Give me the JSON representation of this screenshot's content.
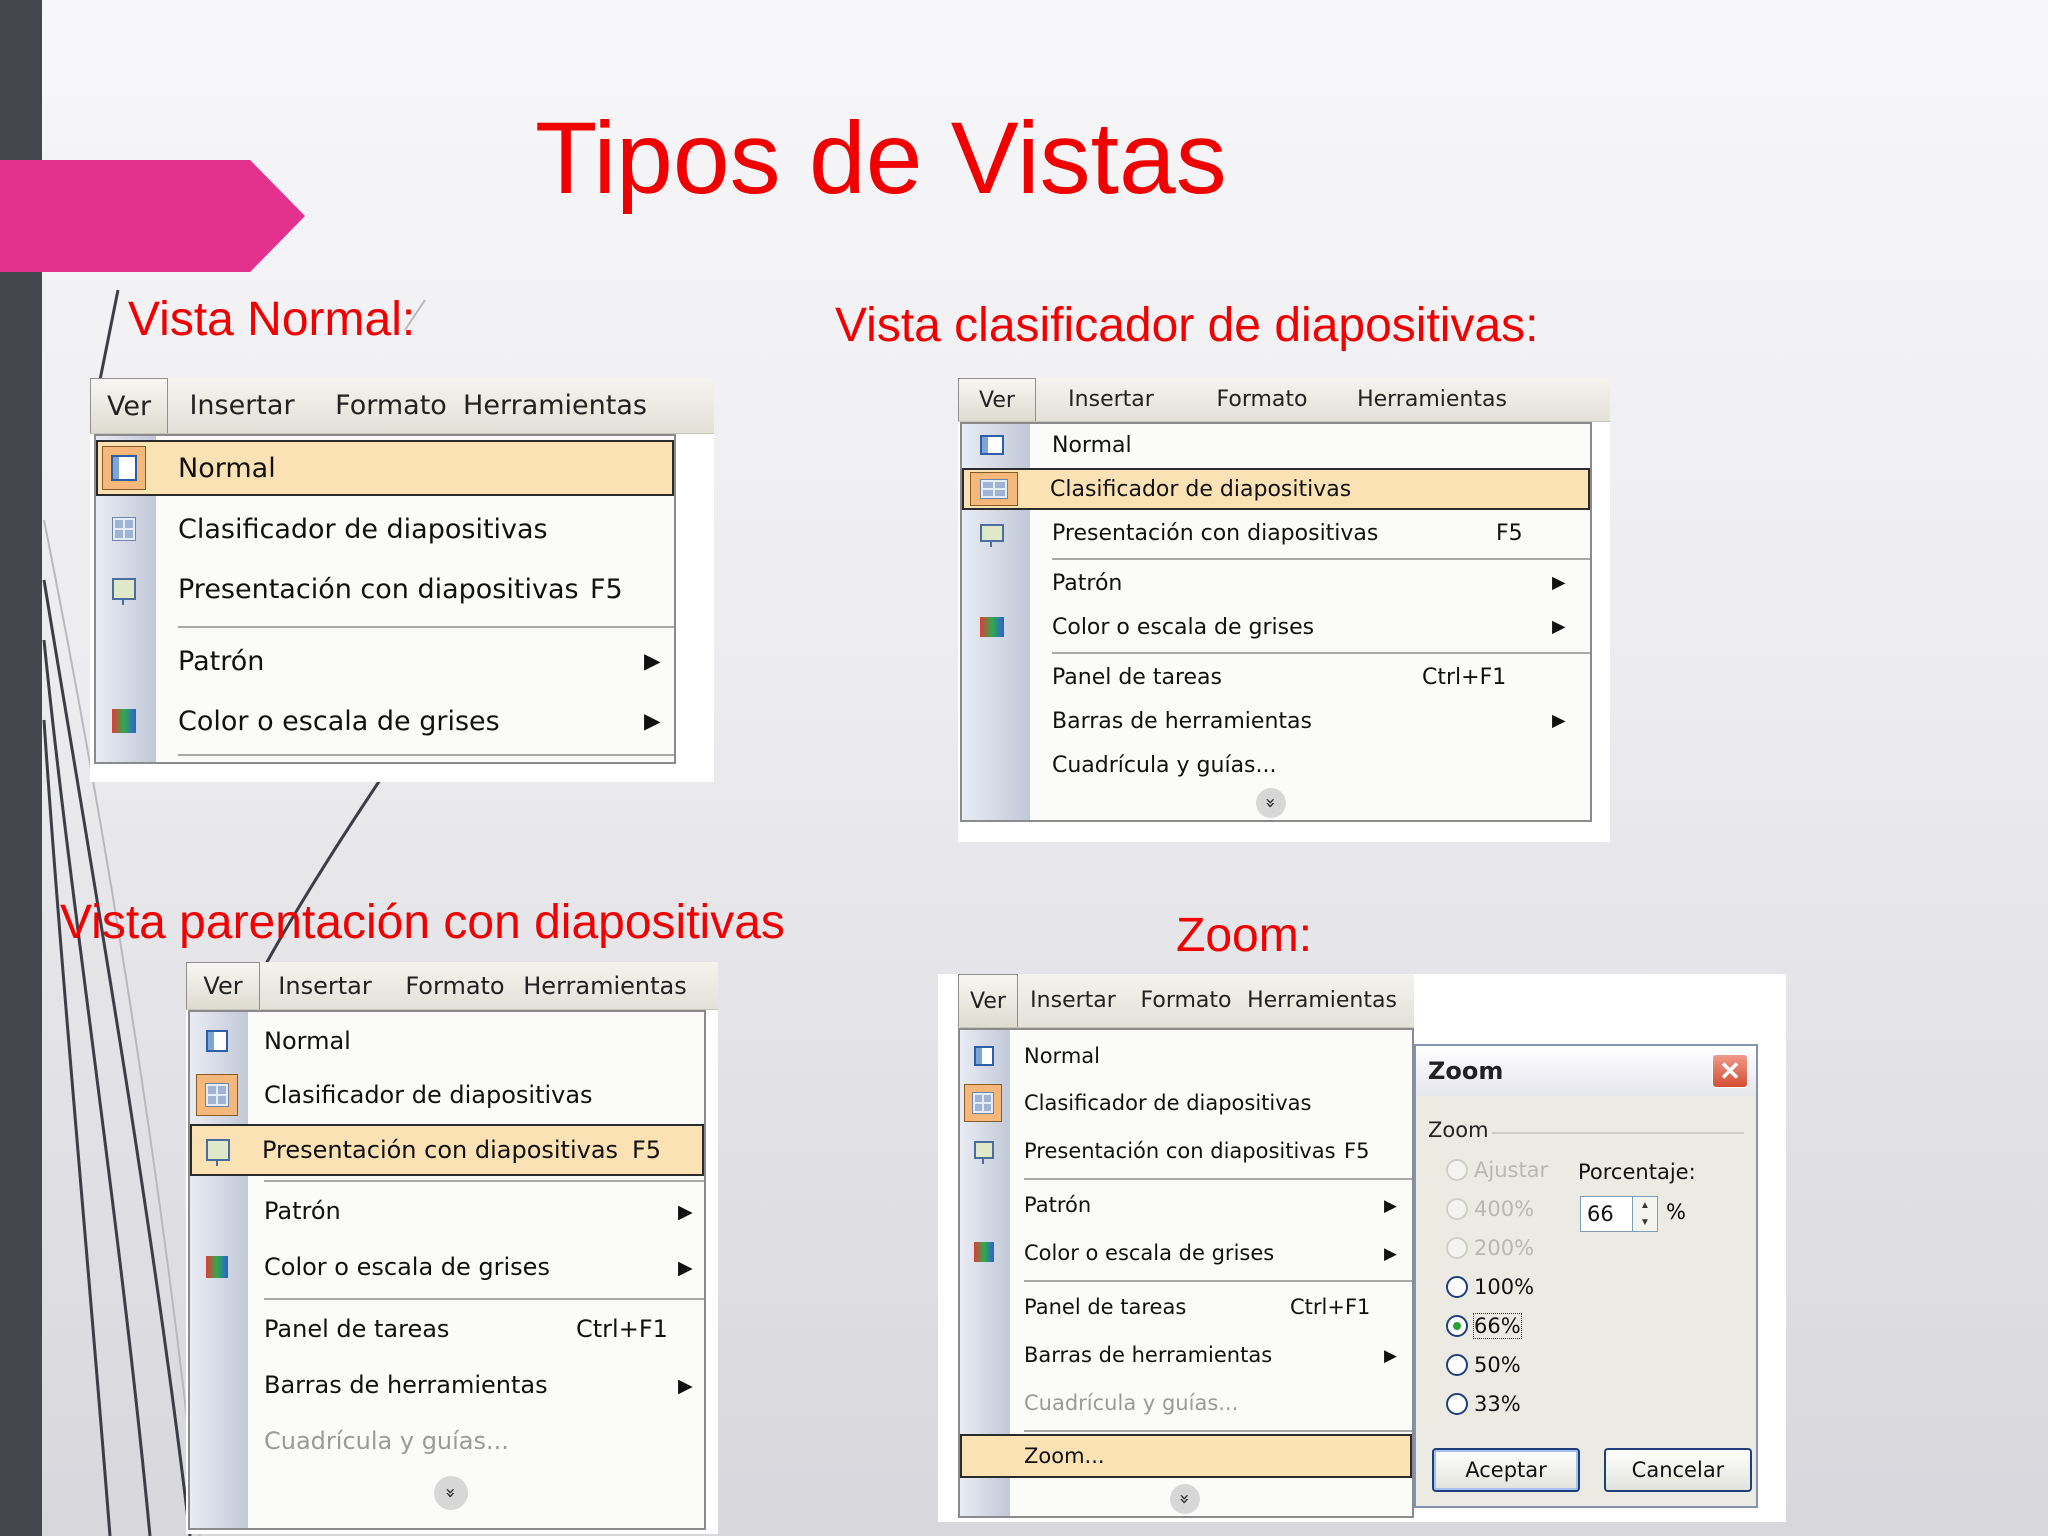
{
  "title": "Tipos de Vistas",
  "captions": {
    "normal": "Vista Normal:",
    "sorter": "Vista clasificador de diapositivas:",
    "slideshow": "Vista parentación con diapositivas",
    "zoom": "Zoom:"
  },
  "menubar": {
    "ver": "Ver",
    "insertar": "Insertar",
    "formato": "Formato",
    "herramientas": "Herramientas"
  },
  "menu": {
    "normal": "Normal",
    "sorter": "Clasificador de diapositivas",
    "slideshow": "Presentación con diapositivas",
    "slideshow_shortcut": "F5",
    "master": "Patrón",
    "color": "Color o escala de grises",
    "taskpane": "Panel de tareas",
    "taskpane_shortcut": "Ctrl+F1",
    "toolbars": "Barras de herramientas",
    "grid": "Cuadrícula y guías...",
    "zoom": "Zoom...",
    "submenu_arrow": "▶",
    "expand": "»"
  },
  "zoom_dialog": {
    "title": "Zoom",
    "group": "Zoom",
    "close": "✕",
    "options": [
      "Ajustar",
      "400%",
      "200%",
      "100%",
      "66%",
      "50%",
      "33%"
    ],
    "selected": "66%",
    "percent_label": "Porcentaje:",
    "percent_value": "66",
    "percent_unit": "%",
    "ok": "Aceptar",
    "cancel": "Cancelar"
  },
  "colors": {
    "title_red": "#f00000",
    "accent_pink": "#e4318f",
    "highlight": "#fbe2b4",
    "sidebar": "#45464e"
  }
}
